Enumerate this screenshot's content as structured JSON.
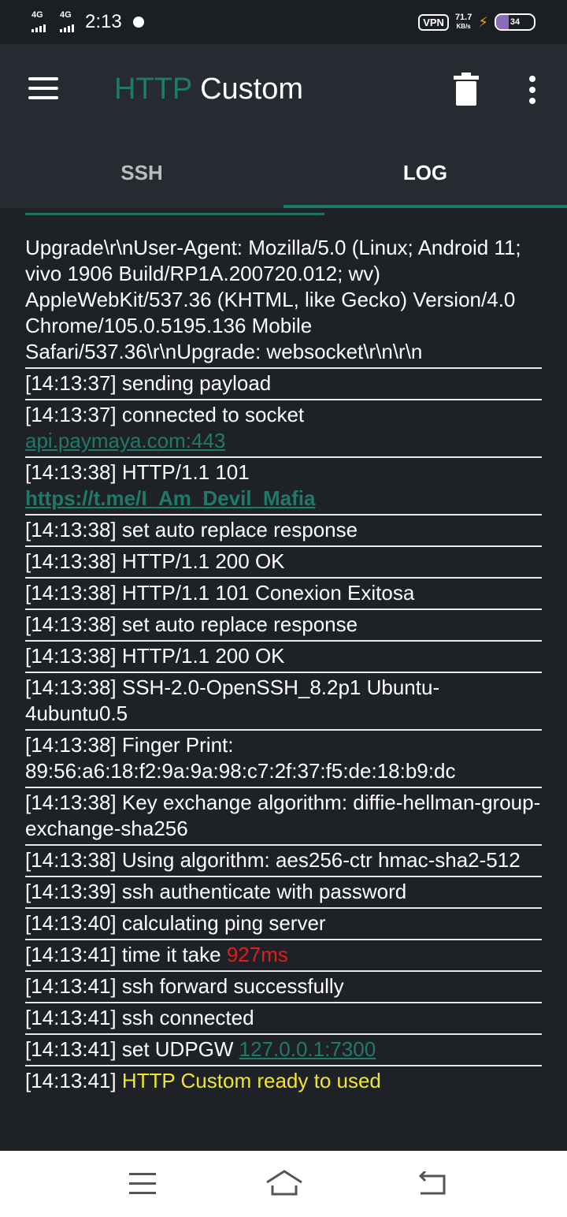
{
  "status": {
    "signal1": "4G",
    "signal2": "4G",
    "time": "2:13",
    "vpn": "VPN",
    "speed_value": "71.7",
    "speed_unit": "KB/s",
    "battery": "34"
  },
  "appbar": {
    "title_part1": "HTTP",
    "title_part2": "Custom"
  },
  "tabs": [
    {
      "label": "SSH"
    },
    {
      "label": "LOG"
    }
  ],
  "log": {
    "top_entry": "Upgrade\\r\\nUser-Agent: Mozilla/5.0 (Linux; Android 11; vivo 1906 Build/RP1A.200720.012; wv) AppleWebKit/537.36 (KHTML, like Gecko) Version/4.0 Chrome/105.0.5195.136 Mobile Safari/537.36\\r\\nUpgrade: websocket\\r\\n\\r\\n",
    "entries": [
      {
        "text": "[14:13:37] sending payload"
      },
      {
        "text": "[14:13:37] connected to socket",
        "link": "api.paymaya.com:443"
      },
      {
        "text": "[14:13:38] HTTP/1.1 101",
        "link": "https://t.me/I_Am_Devil_Mafia"
      },
      {
        "text": "[14:13:38] set auto replace response"
      },
      {
        "text": "[14:13:38] HTTP/1.1 200 OK"
      },
      {
        "text": "[14:13:38] HTTP/1.1 101 Conexion Exitosa"
      },
      {
        "text": "[14:13:38] set auto replace response"
      },
      {
        "text": "[14:13:38] HTTP/1.1 200 OK"
      },
      {
        "text": "[14:13:38] SSH-2.0-OpenSSH_8.2p1 Ubuntu-4ubuntu0.5"
      },
      {
        "text": "[14:13:38] Finger Print: 89:56:a6:18:f2:9a:9a:98:c7:2f:37:f5:de:18:b9:dc"
      },
      {
        "text": "[14:13:38] Key exchange algorithm: diffie-hellman-group-exchange-sha256"
      },
      {
        "text": "[14:13:38] Using algorithm: aes256-ctr hmac-sha2-512"
      },
      {
        "text": "[14:13:39] ssh authenticate with password"
      },
      {
        "text": "[14:13:40] calculating ping server"
      },
      {
        "prefix": "[14:13:41] time it take ",
        "highlight": "927ms"
      },
      {
        "text": "[14:13:41] ssh forward successfully"
      },
      {
        "text": "[14:13:41] ssh connected"
      },
      {
        "prefix": "[14:13:41] set UDPGW ",
        "link": "127.0.0.1:7300"
      },
      {
        "prefix": "[14:13:41] ",
        "highlight": "HTTP Custom ready to used"
      }
    ]
  },
  "colors": {
    "accent": "#1f7a67",
    "error": "#e21b1b",
    "success": "#f2e62b"
  }
}
